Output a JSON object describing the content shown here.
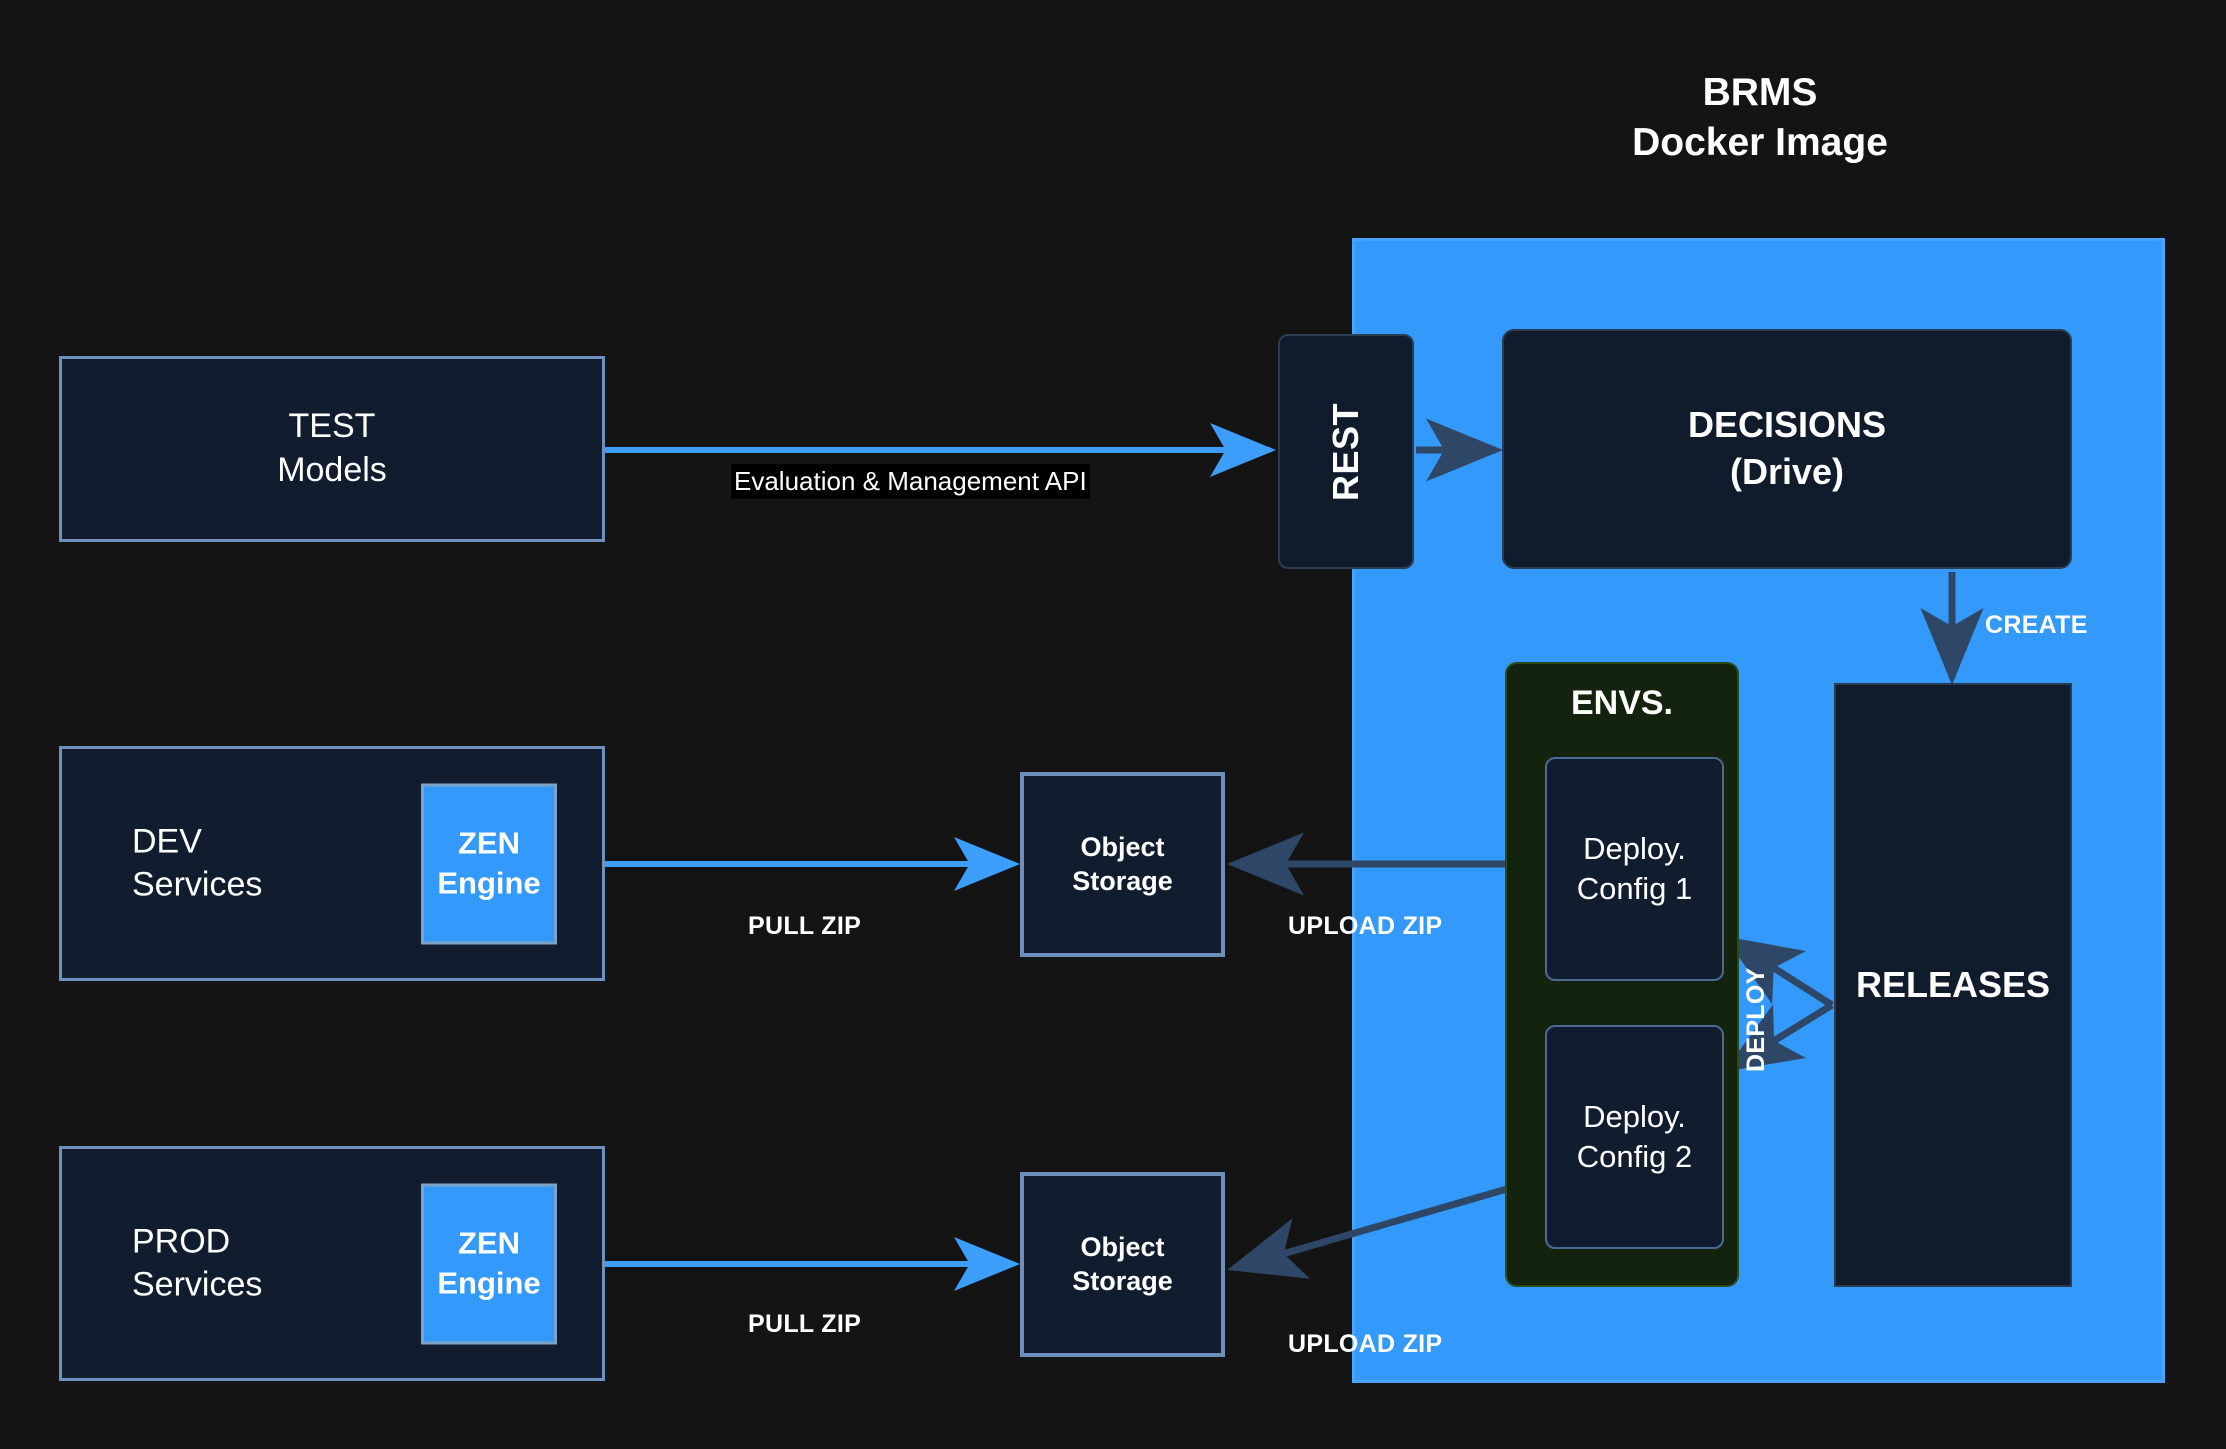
{
  "diagram": {
    "title": "BRMS\nDocker Image",
    "background_color": "#141414",
    "accent_blue": "#3399fb",
    "dark_navy": "#111c2e",
    "env_green": "#13230d",
    "arrow_dark": "#2f4766"
  },
  "external_nodes": {
    "test_models": "TEST\nModels",
    "dev_services": "DEV\nServices",
    "prod_services": "PROD\nServices",
    "zen_engine_dev": "ZEN\nEngine",
    "zen_engine_prod": "ZEN\nEngine",
    "object_storage_dev": "Object\nStorage",
    "object_storage_prod": "Object\nStorage"
  },
  "brms_nodes": {
    "rest": "REST",
    "decisions": "DECISIONS\n(Drive)",
    "envs": "ENVS.",
    "deploy_config_1": "Deploy.\nConfig 1",
    "deploy_config_2": "Deploy.\nConfig 2",
    "releases": "RELEASES"
  },
  "edge_labels": {
    "evaluation_api": "Evaluation & Management API",
    "pull_zip_dev": "PULL ZIP",
    "pull_zip_prod": "PULL ZIP",
    "upload_zip_dev": "UPLOAD ZIP",
    "upload_zip_prod": "UPLOAD ZIP",
    "create": "CREATE",
    "deploy": "DEPLOY"
  }
}
